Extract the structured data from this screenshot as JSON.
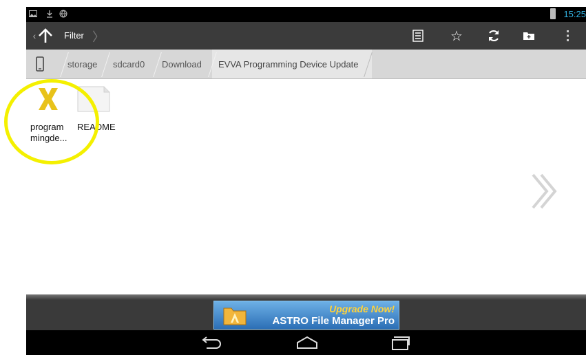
{
  "status_bar": {
    "time": "15:25",
    "icons": [
      "picture-icon",
      "download-icon",
      "globe-icon"
    ],
    "battery_icon": "battery-icon",
    "time_color": "#33b5e5"
  },
  "action_bar": {
    "filter_label": "Filter",
    "buttons": [
      "list-view-icon",
      "star-icon",
      "refresh-icon",
      "new-folder-icon",
      "overflow-menu-icon"
    ]
  },
  "breadcrumb": {
    "items": [
      "storage",
      "sdcard0",
      "Download",
      "EVVA Programming Device Update"
    ]
  },
  "files": [
    {
      "name_line1": "program",
      "name_line2": "mingde...",
      "icon": "x-app-icon",
      "icon_color": "#e8c21a"
    },
    {
      "name_line1": "README",
      "name_line2": "",
      "icon": "text-file-icon"
    }
  ],
  "highlight_color": "#f4f000",
  "ad": {
    "line1": "Upgrade Now!",
    "line2": "ASTRO File Manager Pro",
    "icon": "astro-folder-icon"
  },
  "nav_bar": {
    "buttons": [
      "back-icon",
      "home-icon",
      "recent-apps-icon"
    ]
  }
}
